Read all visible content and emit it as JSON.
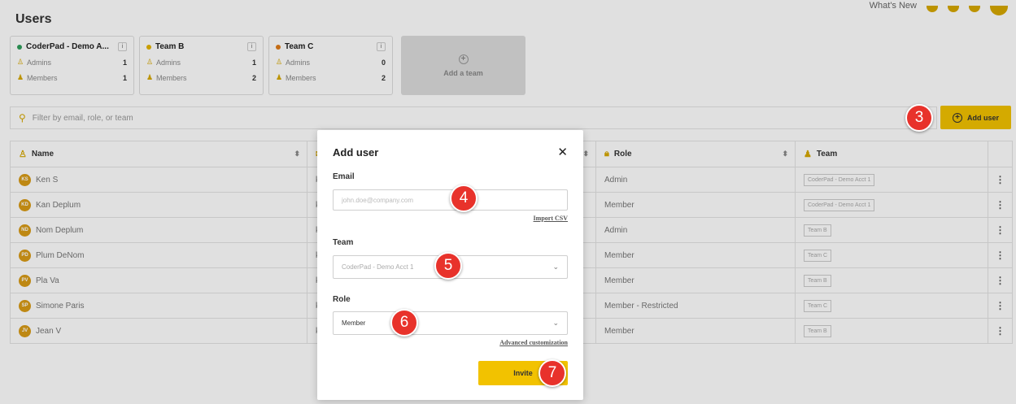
{
  "page": {
    "title": "Users"
  },
  "topbar": {
    "whats_new": "What's New"
  },
  "teams": [
    {
      "name": "CoderPad - Demo A...",
      "color": "#2e9e5b",
      "admins_label": "Admins",
      "admins": "1",
      "members_label": "Members",
      "members": "1"
    },
    {
      "name": "Team B",
      "color": "#e5b400",
      "admins_label": "Admins",
      "admins": "1",
      "members_label": "Members",
      "members": "2"
    },
    {
      "name": "Team C",
      "color": "#e07b18",
      "admins_label": "Admins",
      "admins": "0",
      "members_label": "Members",
      "members": "2"
    }
  ],
  "add_team": {
    "label": "Add a team"
  },
  "filter": {
    "placeholder": "Filter by email, role, or team"
  },
  "add_user_button": {
    "label": "Add user"
  },
  "table": {
    "columns": {
      "name": "Name",
      "role": "Role",
      "team": "Team"
    },
    "rows": [
      {
        "initials": "KS",
        "name": "Ken S",
        "email": "ke",
        "role": "Admin",
        "team": "CoderPad - Demo Acct 1"
      },
      {
        "initials": "KD",
        "name": "Kan Deplum",
        "email": "ke",
        "role": "Member",
        "team": "CoderPad - Demo Acct 1"
      },
      {
        "initials": "ND",
        "name": "Nom Deplum",
        "email": "ke",
        "role": "Admin",
        "team": "Team B"
      },
      {
        "initials": "PD",
        "name": "Plum DeNom",
        "email": "ke",
        "role": "Member",
        "team": "Team C"
      },
      {
        "initials": "PV",
        "name": "Pla Va",
        "email": "ke",
        "role": "Member",
        "team": "Team B"
      },
      {
        "initials": "SP",
        "name": "Simone Paris",
        "email": "ke",
        "role": "Member - Restricted",
        "team": "Team C"
      },
      {
        "initials": "JV",
        "name": "Jean V",
        "email": "ke",
        "role": "Member",
        "team": "Team B"
      }
    ]
  },
  "modal": {
    "title": "Add user",
    "close": "✕",
    "email_label": "Email",
    "email_placeholder": "john.doe@company.com",
    "import_csv": "Import CSV",
    "team_label": "Team",
    "team_value": "CoderPad - Demo Acct 1",
    "role_label": "Role",
    "role_value": "Member",
    "advanced": "Advanced customization",
    "invite": "Invite"
  },
  "steps": [
    "3",
    "4",
    "5",
    "6",
    "7"
  ]
}
